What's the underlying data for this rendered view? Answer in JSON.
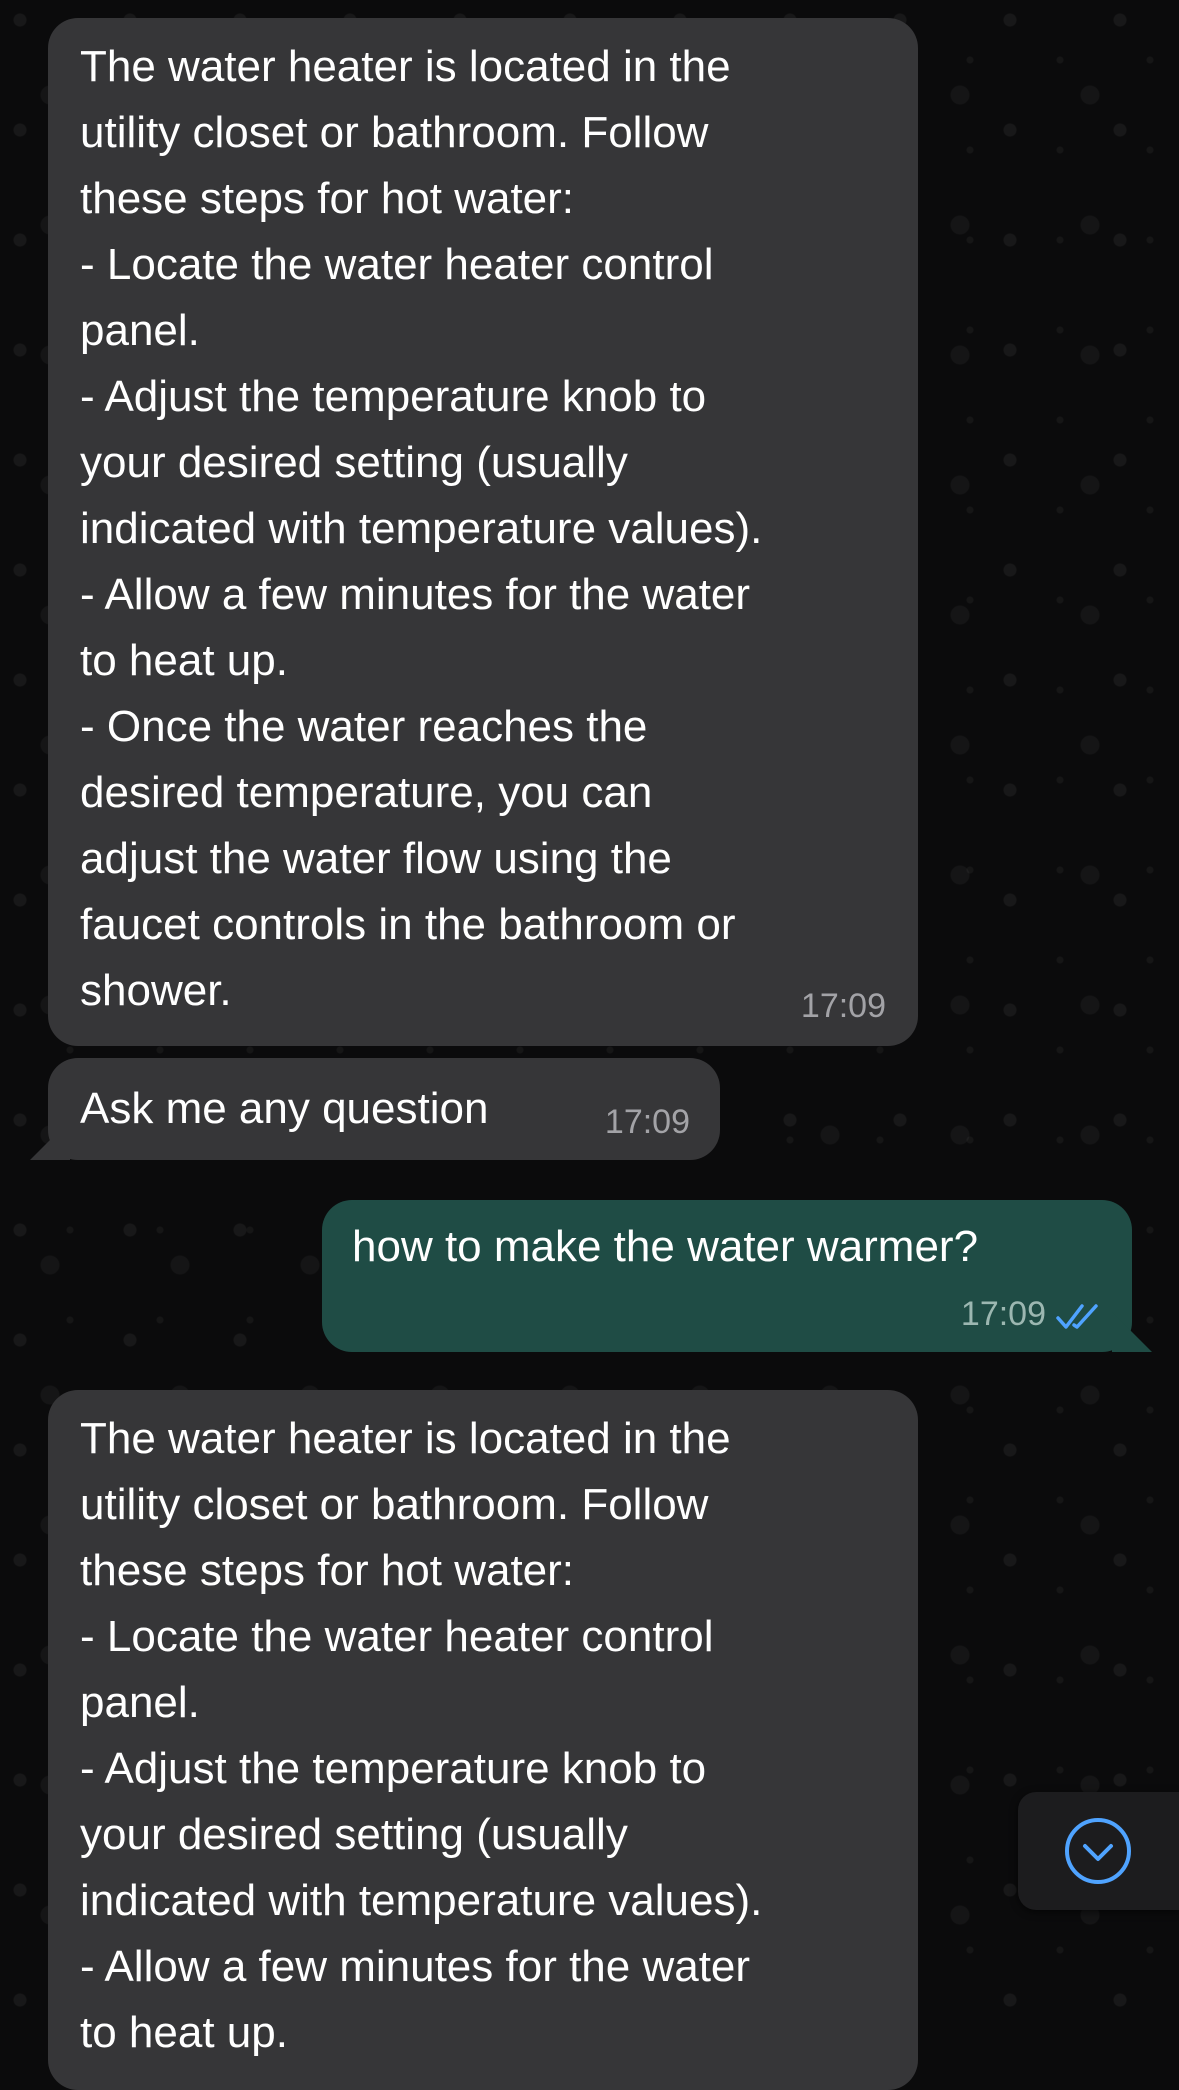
{
  "colors": {
    "incoming_bubble": "#363638",
    "outgoing_bubble": "#1f4c45",
    "read_ticks": "#4fa3ff",
    "scroll_button_accent": "#4fa3ff"
  },
  "messages": [
    {
      "direction": "incoming",
      "text": "The water heater is located in the\nutility closet or bathroom. Follow\nthese steps for hot water:\n- Locate the water heater control\npanel.\n- Adjust the temperature knob to\nyour desired setting (usually\nindicated with temperature values).\n- Allow a few minutes for the water\nto heat up.\n- Once the water reaches the\ndesired temperature, you can\nadjust the water flow using the\nfaucet controls in the bathroom or\nshower.",
      "time": "17:09"
    },
    {
      "direction": "incoming",
      "text": "Ask me any question",
      "time": "17:09"
    },
    {
      "direction": "outgoing",
      "text": "how to make the water warmer?",
      "time": "17:09",
      "status": "read"
    },
    {
      "direction": "incoming",
      "text": "The water heater is located in the\nutility closet or bathroom. Follow\nthese steps for hot water:\n- Locate the water heater control\npanel.\n- Adjust the temperature knob to\nyour desired setting (usually\nindicated with temperature values).\n- Allow a few minutes for the water\nto heat up.",
      "time": ""
    }
  ],
  "scroll_button": {
    "icon": "chevron-down-circle-icon"
  }
}
